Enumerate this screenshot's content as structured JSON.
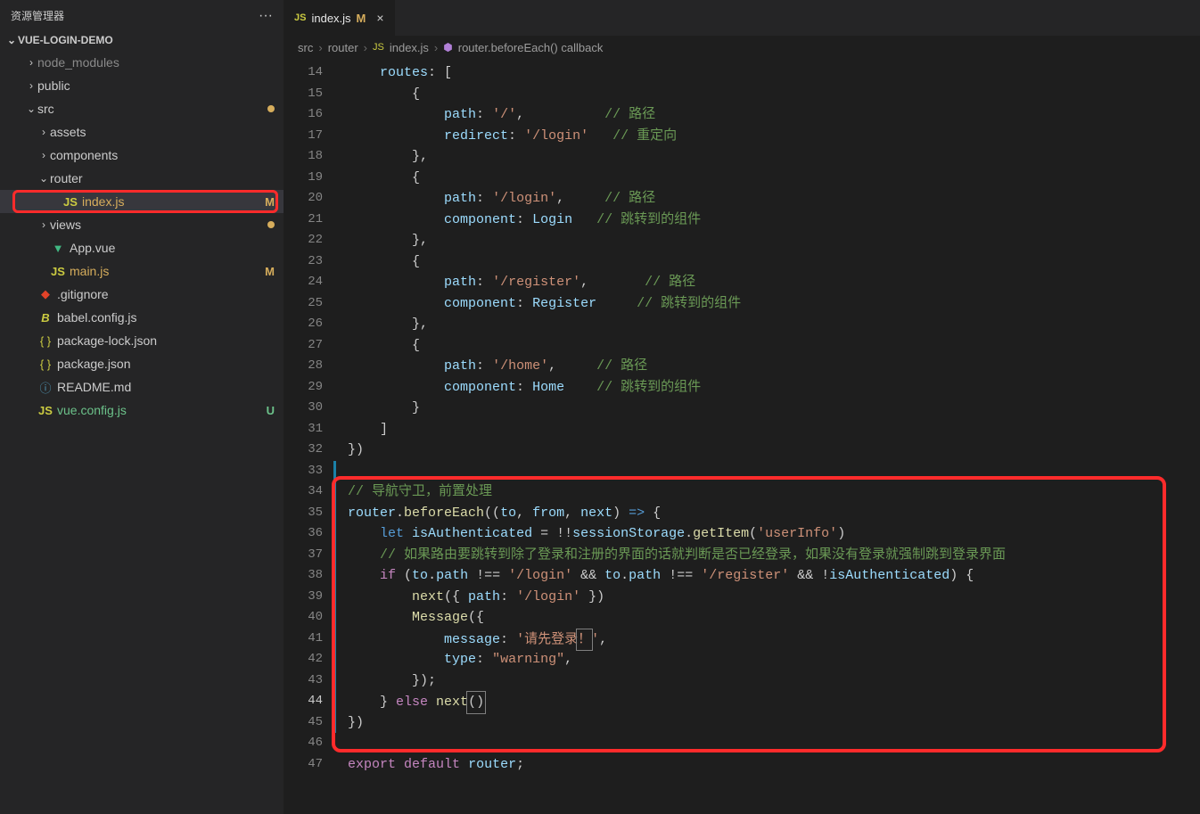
{
  "sidebar": {
    "title": "资源管理器",
    "project": "VUE-LOGIN-DEMO",
    "items": [
      {
        "label": "node_modules",
        "type": "folder",
        "chev": "›",
        "indent": 1,
        "dim": true
      },
      {
        "label": "public",
        "type": "folder",
        "chev": "›",
        "indent": 1
      },
      {
        "label": "src",
        "type": "folder",
        "chev": "⌄",
        "indent": 1,
        "dot": true
      },
      {
        "label": "assets",
        "type": "folder",
        "chev": "›",
        "indent": 2
      },
      {
        "label": "components",
        "type": "folder",
        "chev": "›",
        "indent": 2
      },
      {
        "label": "router",
        "type": "folder",
        "chev": "⌄",
        "indent": 2
      },
      {
        "label": "index.js",
        "type": "js",
        "indent": 3,
        "status": "M",
        "selected": true,
        "highlight": true
      },
      {
        "label": "views",
        "type": "folder",
        "chev": "›",
        "indent": 2,
        "dot": true
      },
      {
        "label": "App.vue",
        "type": "vue",
        "indent": 2
      },
      {
        "label": "main.js",
        "type": "js",
        "indent": 2,
        "status": "M"
      },
      {
        "label": ".gitignore",
        "type": "git",
        "indent": 1
      },
      {
        "label": "babel.config.js",
        "type": "babel",
        "indent": 1
      },
      {
        "label": "package-lock.json",
        "type": "json",
        "indent": 1
      },
      {
        "label": "package.json",
        "type": "json",
        "indent": 1
      },
      {
        "label": "README.md",
        "type": "md",
        "indent": 1
      },
      {
        "label": "vue.config.js",
        "type": "js",
        "indent": 1,
        "status": "U",
        "greenlabel": true
      }
    ]
  },
  "tab": {
    "name": "index.js",
    "mod": "M"
  },
  "breadcrumbs": {
    "p1": "src",
    "p2": "router",
    "p3": "index.js",
    "p4": "router.beforeEach() callback"
  },
  "code": {
    "start": 14,
    "lines": [
      {
        "n": 14,
        "html": "    <span class='tok-prop'>routes</span>: ["
      },
      {
        "n": 15,
        "html": "        {"
      },
      {
        "n": 16,
        "html": "            <span class='tok-prop'>path</span>: <span class='tok-str'>'/'</span>,          <span class='tok-comment'>// 路径</span>"
      },
      {
        "n": 17,
        "html": "            <span class='tok-prop'>redirect</span>: <span class='tok-str'>'/login'</span>   <span class='tok-comment'>// 重定向</span>"
      },
      {
        "n": 18,
        "html": "        },"
      },
      {
        "n": 19,
        "html": "        {"
      },
      {
        "n": 20,
        "html": "            <span class='tok-prop'>path</span>: <span class='tok-str'>'/login'</span>,     <span class='tok-comment'>// 路径</span>"
      },
      {
        "n": 21,
        "html": "            <span class='tok-prop'>component</span>: <span class='tok-ident'>Login</span>   <span class='tok-comment'>// 跳转到的组件</span>"
      },
      {
        "n": 22,
        "html": "        },"
      },
      {
        "n": 23,
        "html": "        {"
      },
      {
        "n": 24,
        "html": "            <span class='tok-prop'>path</span>: <span class='tok-str'>'/register'</span>,       <span class='tok-comment'>// 路径</span>"
      },
      {
        "n": 25,
        "html": "            <span class='tok-prop'>component</span>: <span class='tok-ident'>Register</span>     <span class='tok-comment'>// 跳转到的组件</span>"
      },
      {
        "n": 26,
        "html": "        },"
      },
      {
        "n": 27,
        "html": "        {"
      },
      {
        "n": 28,
        "html": "            <span class='tok-prop'>path</span>: <span class='tok-str'>'/home'</span>,     <span class='tok-comment'>// 路径</span>"
      },
      {
        "n": 29,
        "html": "            <span class='tok-prop'>component</span>: <span class='tok-ident'>Home</span>    <span class='tok-comment'>// 跳转到的组件</span>"
      },
      {
        "n": 30,
        "html": "        }"
      },
      {
        "n": 31,
        "html": "    ]"
      },
      {
        "n": 32,
        "html": "})"
      },
      {
        "n": 33,
        "html": "",
        "changed": true
      },
      {
        "n": 34,
        "html": "<span class='tok-comment'>// 导航守卫，前置处理</span>",
        "changed": true
      },
      {
        "n": 35,
        "html": "<span class='tok-ident'>router</span>.<span class='tok-fn'>beforeEach</span>((<span class='tok-ident'>to</span>, <span class='tok-ident'>from</span>, <span class='tok-ident'>next</span>) <span class='tok-kw'>=&gt;</span> {",
        "changed": true
      },
      {
        "n": 36,
        "html": "    <span class='tok-kw'>let</span> <span class='tok-ident'>isAuthenticated</span> = !!<span class='tok-ident'>sessionStorage</span>.<span class='tok-fn'>getItem</span>(<span class='tok-str'>'userInfo'</span>)",
        "changed": true
      },
      {
        "n": 37,
        "html": "    <span class='tok-comment'>// 如果路由要跳转到除了登录和注册的界面的话就判断是否已经登录，如果没有登录就强制跳到登录界面</span>",
        "changed": true
      },
      {
        "n": 38,
        "html": "    <span class='tok-kwp'>if</span> (<span class='tok-ident'>to</span>.<span class='tok-ident'>path</span> !== <span class='tok-str'>'/login'</span> &amp;&amp; <span class='tok-ident'>to</span>.<span class='tok-ident'>path</span> !== <span class='tok-str'>'/register'</span> &amp;&amp; !<span class='tok-ident'>isAuthenticated</span>) {",
        "changed": true
      },
      {
        "n": 39,
        "html": "        <span class='tok-fn'>next</span>({ <span class='tok-prop'>path</span>: <span class='tok-str'>'/login'</span> })",
        "changed": true
      },
      {
        "n": 40,
        "html": "        <span class='tok-fn'>Message</span>({",
        "changed": true
      },
      {
        "n": 41,
        "html": "            <span class='tok-prop'>message</span>: <span class='tok-str'>'请先登录<span class='cursor-box'>！</span>'</span>,",
        "changed": true
      },
      {
        "n": 42,
        "html": "            <span class='tok-prop'>type</span>: <span class='tok-str'>\"warning\"</span>,",
        "changed": true
      },
      {
        "n": 43,
        "html": "        });",
        "changed": true
      },
      {
        "n": 44,
        "html": "    } <span class='tok-kwp'>else</span> <span class='tok-fn'>next</span><span class='cursor-box'>()</span>",
        "changed": true,
        "current": true
      },
      {
        "n": 45,
        "html": "})",
        "changed": true
      },
      {
        "n": 46,
        "html": ""
      },
      {
        "n": 47,
        "html": "<span class='tok-kwp'>export</span> <span class='tok-kwp'>default</span> <span class='tok-ident'>router</span>;"
      }
    ]
  }
}
